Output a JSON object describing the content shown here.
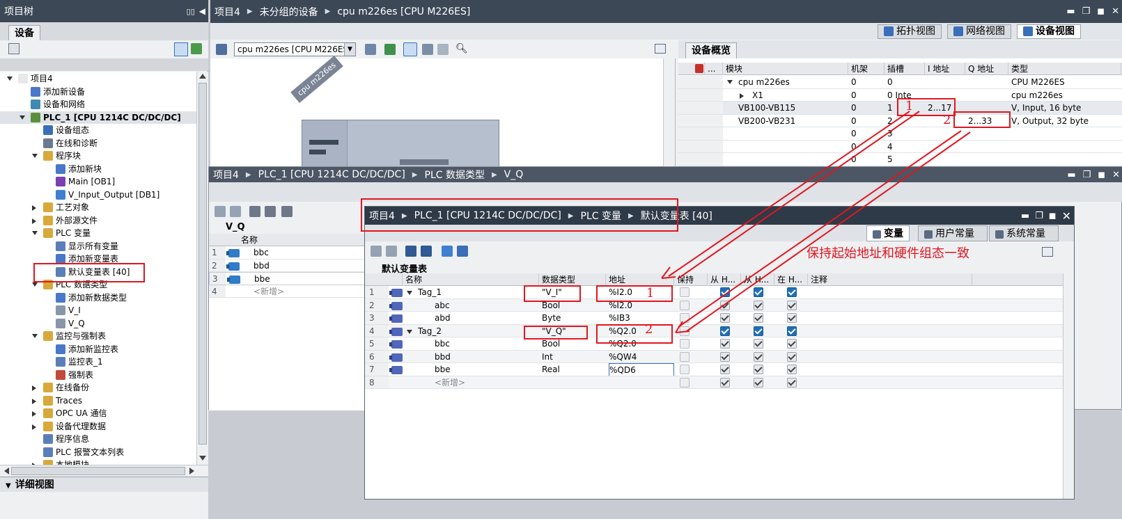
{
  "project_tree": {
    "title": "项目树",
    "tab": "设备",
    "items": [
      {
        "label": "项目4",
        "indent": 0,
        "exp": "down",
        "icon": "#e8e8e8"
      },
      {
        "label": "添加新设备",
        "indent": 1,
        "exp": "",
        "icon": "#4a78c8"
      },
      {
        "label": "设备和网络",
        "indent": 1,
        "exp": "",
        "icon": "#3f8ab5"
      },
      {
        "label": "PLC_1 [CPU 1214C DC/DC/DC]",
        "indent": 1,
        "exp": "down",
        "icon": "#5c8f3a",
        "selected": true
      },
      {
        "label": "设备组态",
        "indent": 2,
        "exp": "",
        "icon": "#3a6fb8"
      },
      {
        "label": "在线和诊断",
        "indent": 2,
        "exp": "",
        "icon": "#6a7a8c"
      },
      {
        "label": "程序块",
        "indent": 2,
        "exp": "down",
        "icon": "#d8a93a"
      },
      {
        "label": "添加新块",
        "indent": 3,
        "exp": "",
        "icon": "#4a78c8"
      },
      {
        "label": "Main [OB1]",
        "indent": 3,
        "exp": "",
        "icon": "#7a3fb0"
      },
      {
        "label": "V_Input_Output [DB1]",
        "indent": 3,
        "exp": "",
        "icon": "#3f7fd0"
      },
      {
        "label": "工艺对象",
        "indent": 2,
        "exp": "right",
        "icon": "#d8a93a"
      },
      {
        "label": "外部源文件",
        "indent": 2,
        "exp": "right",
        "icon": "#d8a93a"
      },
      {
        "label": "PLC 变量",
        "indent": 2,
        "exp": "down",
        "icon": "#d8a93a"
      },
      {
        "label": "显示所有变量",
        "indent": 3,
        "exp": "",
        "icon": "#5a7fb8"
      },
      {
        "label": "添加新变量表",
        "indent": 3,
        "exp": "",
        "icon": "#4a78c8"
      },
      {
        "label": "默认变量表 [40]",
        "indent": 3,
        "exp": "",
        "icon": "#5a7fb8"
      },
      {
        "label": "PLC 数据类型",
        "indent": 2,
        "exp": "down",
        "icon": "#d8a93a"
      },
      {
        "label": "添加新数据类型",
        "indent": 3,
        "exp": "",
        "icon": "#4a78c8"
      },
      {
        "label": "V_I",
        "indent": 3,
        "exp": "",
        "icon": "#8896a8"
      },
      {
        "label": "V_Q",
        "indent": 3,
        "exp": "",
        "icon": "#8896a8"
      },
      {
        "label": "监控与强制表",
        "indent": 2,
        "exp": "down",
        "icon": "#d8a93a"
      },
      {
        "label": "添加新监控表",
        "indent": 3,
        "exp": "",
        "icon": "#4a78c8"
      },
      {
        "label": "监控表_1",
        "indent": 3,
        "exp": "",
        "icon": "#5a7fb8"
      },
      {
        "label": "强制表",
        "indent": 3,
        "exp": "",
        "icon": "#c04a3a"
      },
      {
        "label": "在线备份",
        "indent": 2,
        "exp": "right",
        "icon": "#d8a93a"
      },
      {
        "label": "Traces",
        "indent": 2,
        "exp": "right",
        "icon": "#d8a93a"
      },
      {
        "label": "OPC UA 通信",
        "indent": 2,
        "exp": "right",
        "icon": "#d8a93a"
      },
      {
        "label": "设备代理数据",
        "indent": 2,
        "exp": "right",
        "icon": "#d8a93a"
      },
      {
        "label": "程序信息",
        "indent": 2,
        "exp": "",
        "icon": "#5a7fb8"
      },
      {
        "label": "PLC 报警文本列表",
        "indent": 2,
        "exp": "",
        "icon": "#5a7fb8"
      },
      {
        "label": "本地模块",
        "indent": 2,
        "exp": "right",
        "icon": "#d8a93a"
      }
    ],
    "detail_view": "详细视图"
  },
  "device_window": {
    "breadcrumb": [
      "项目4",
      "未分组的设备",
      "cpu m226es [CPU M226ES]"
    ],
    "view_tabs": [
      "拓扑视图",
      "网络视图",
      "设备视图"
    ],
    "device_select": "cpu m226es [CPU M226ES]",
    "device_label": "cpu m226es",
    "overview_tab": "设备概览",
    "overview_headers": [
      "模块",
      "机架",
      "插槽",
      "I 地址",
      "Q 地址",
      "类型"
    ],
    "overview_rows": [
      {
        "module": "cpu m226es",
        "rack": "0",
        "slot": "0",
        "i": "",
        "q": "",
        "type": "CPU M226ES",
        "exp": "down",
        "indent": 0
      },
      {
        "module": "X1",
        "rack": "0",
        "slot": "0 Inte",
        "i": "",
        "q": "",
        "type": "cpu m226es",
        "exp": "right",
        "indent": 1
      },
      {
        "module": "VB100-VB115",
        "rack": "0",
        "slot": "1",
        "i": "2...17",
        "q": "",
        "type": "V, Input,   16 byte",
        "exp": "",
        "indent": 0
      },
      {
        "module": "VB200-VB231",
        "rack": "0",
        "slot": "2",
        "i": "",
        "q": "2...33",
        "type": "V, Output,   32 byte",
        "exp": "",
        "indent": 0
      },
      {
        "module": "",
        "rack": "0",
        "slot": "3",
        "i": "",
        "q": "",
        "type": "",
        "exp": "",
        "indent": 0
      },
      {
        "module": "",
        "rack": "0",
        "slot": "4",
        "i": "",
        "q": "",
        "type": "",
        "exp": "",
        "indent": 0
      },
      {
        "module": "",
        "rack": "0",
        "slot": "5",
        "i": "",
        "q": "",
        "type": "",
        "exp": "",
        "indent": 0
      }
    ]
  },
  "datatype_window": {
    "breadcrumb": [
      "项目4",
      "PLC_1 [CPU 1214C DC/DC/DC]",
      "PLC 数据类型",
      "V_Q"
    ],
    "type_name": "V_Q",
    "col_name": "名称",
    "rows": [
      {
        "no": "1",
        "name": "bbc"
      },
      {
        "no": "2",
        "name": "bbd"
      },
      {
        "no": "3",
        "name": "bbe"
      },
      {
        "no": "4",
        "name": "<新增>"
      }
    ]
  },
  "tag_window": {
    "breadcrumb": [
      "项目4",
      "PLC_1 [CPU 1214C DC/DC/DC]",
      "PLC 变量",
      "默认变量表 [40]"
    ],
    "tabs": [
      "变量",
      "用户常量",
      "系统常量"
    ],
    "table_title": "默认变量表",
    "headers": [
      "名称",
      "数据类型",
      "地址",
      "保持",
      "从 H...",
      "从 H...",
      "在 H...",
      "注释"
    ],
    "rows": [
      {
        "no": "1",
        "name": "Tag_1",
        "type": "\"V_I\"",
        "addr": "%I2.0",
        "keep": false,
        "c1": true,
        "c2": true,
        "c3": true,
        "exp": true,
        "child": false,
        "active": true
      },
      {
        "no": "2",
        "name": "abc",
        "type": "Bool",
        "addr": "%I2.0",
        "keep": false,
        "c1": true,
        "c2": true,
        "c3": true,
        "exp": false,
        "child": true,
        "active": false
      },
      {
        "no": "3",
        "name": "abd",
        "type": "Byte",
        "addr": "%IB3",
        "keep": false,
        "c1": true,
        "c2": true,
        "c3": true,
        "exp": false,
        "child": true,
        "active": false
      },
      {
        "no": "4",
        "name": "Tag_2",
        "type": "\"V_Q\"",
        "addr": "%Q2.0",
        "keep": false,
        "c1": true,
        "c2": true,
        "c3": true,
        "exp": true,
        "child": false,
        "active": true
      },
      {
        "no": "5",
        "name": "bbc",
        "type": "Bool",
        "addr": "%Q2.0",
        "keep": false,
        "c1": true,
        "c2": true,
        "c3": true,
        "exp": false,
        "child": true,
        "active": false
      },
      {
        "no": "6",
        "name": "bbd",
        "type": "Int",
        "addr": "%QW4",
        "keep": false,
        "c1": true,
        "c2": true,
        "c3": true,
        "exp": false,
        "child": true,
        "active": false
      },
      {
        "no": "7",
        "name": "bbe",
        "type": "Real",
        "addr": "%QD6",
        "keep": false,
        "c1": true,
        "c2": true,
        "c3": true,
        "exp": false,
        "child": true,
        "active": false
      },
      {
        "no": "8",
        "name": "<新增>",
        "type": "",
        "addr": "",
        "keep": false,
        "c1": true,
        "c2": true,
        "c3": true,
        "exp": false,
        "child": true,
        "active": false,
        "new": true
      }
    ]
  },
  "annotation": {
    "text": "保持起始地址和硬件组态一致",
    "marker1": "1",
    "marker2": "2",
    "color": "#e0161f"
  }
}
